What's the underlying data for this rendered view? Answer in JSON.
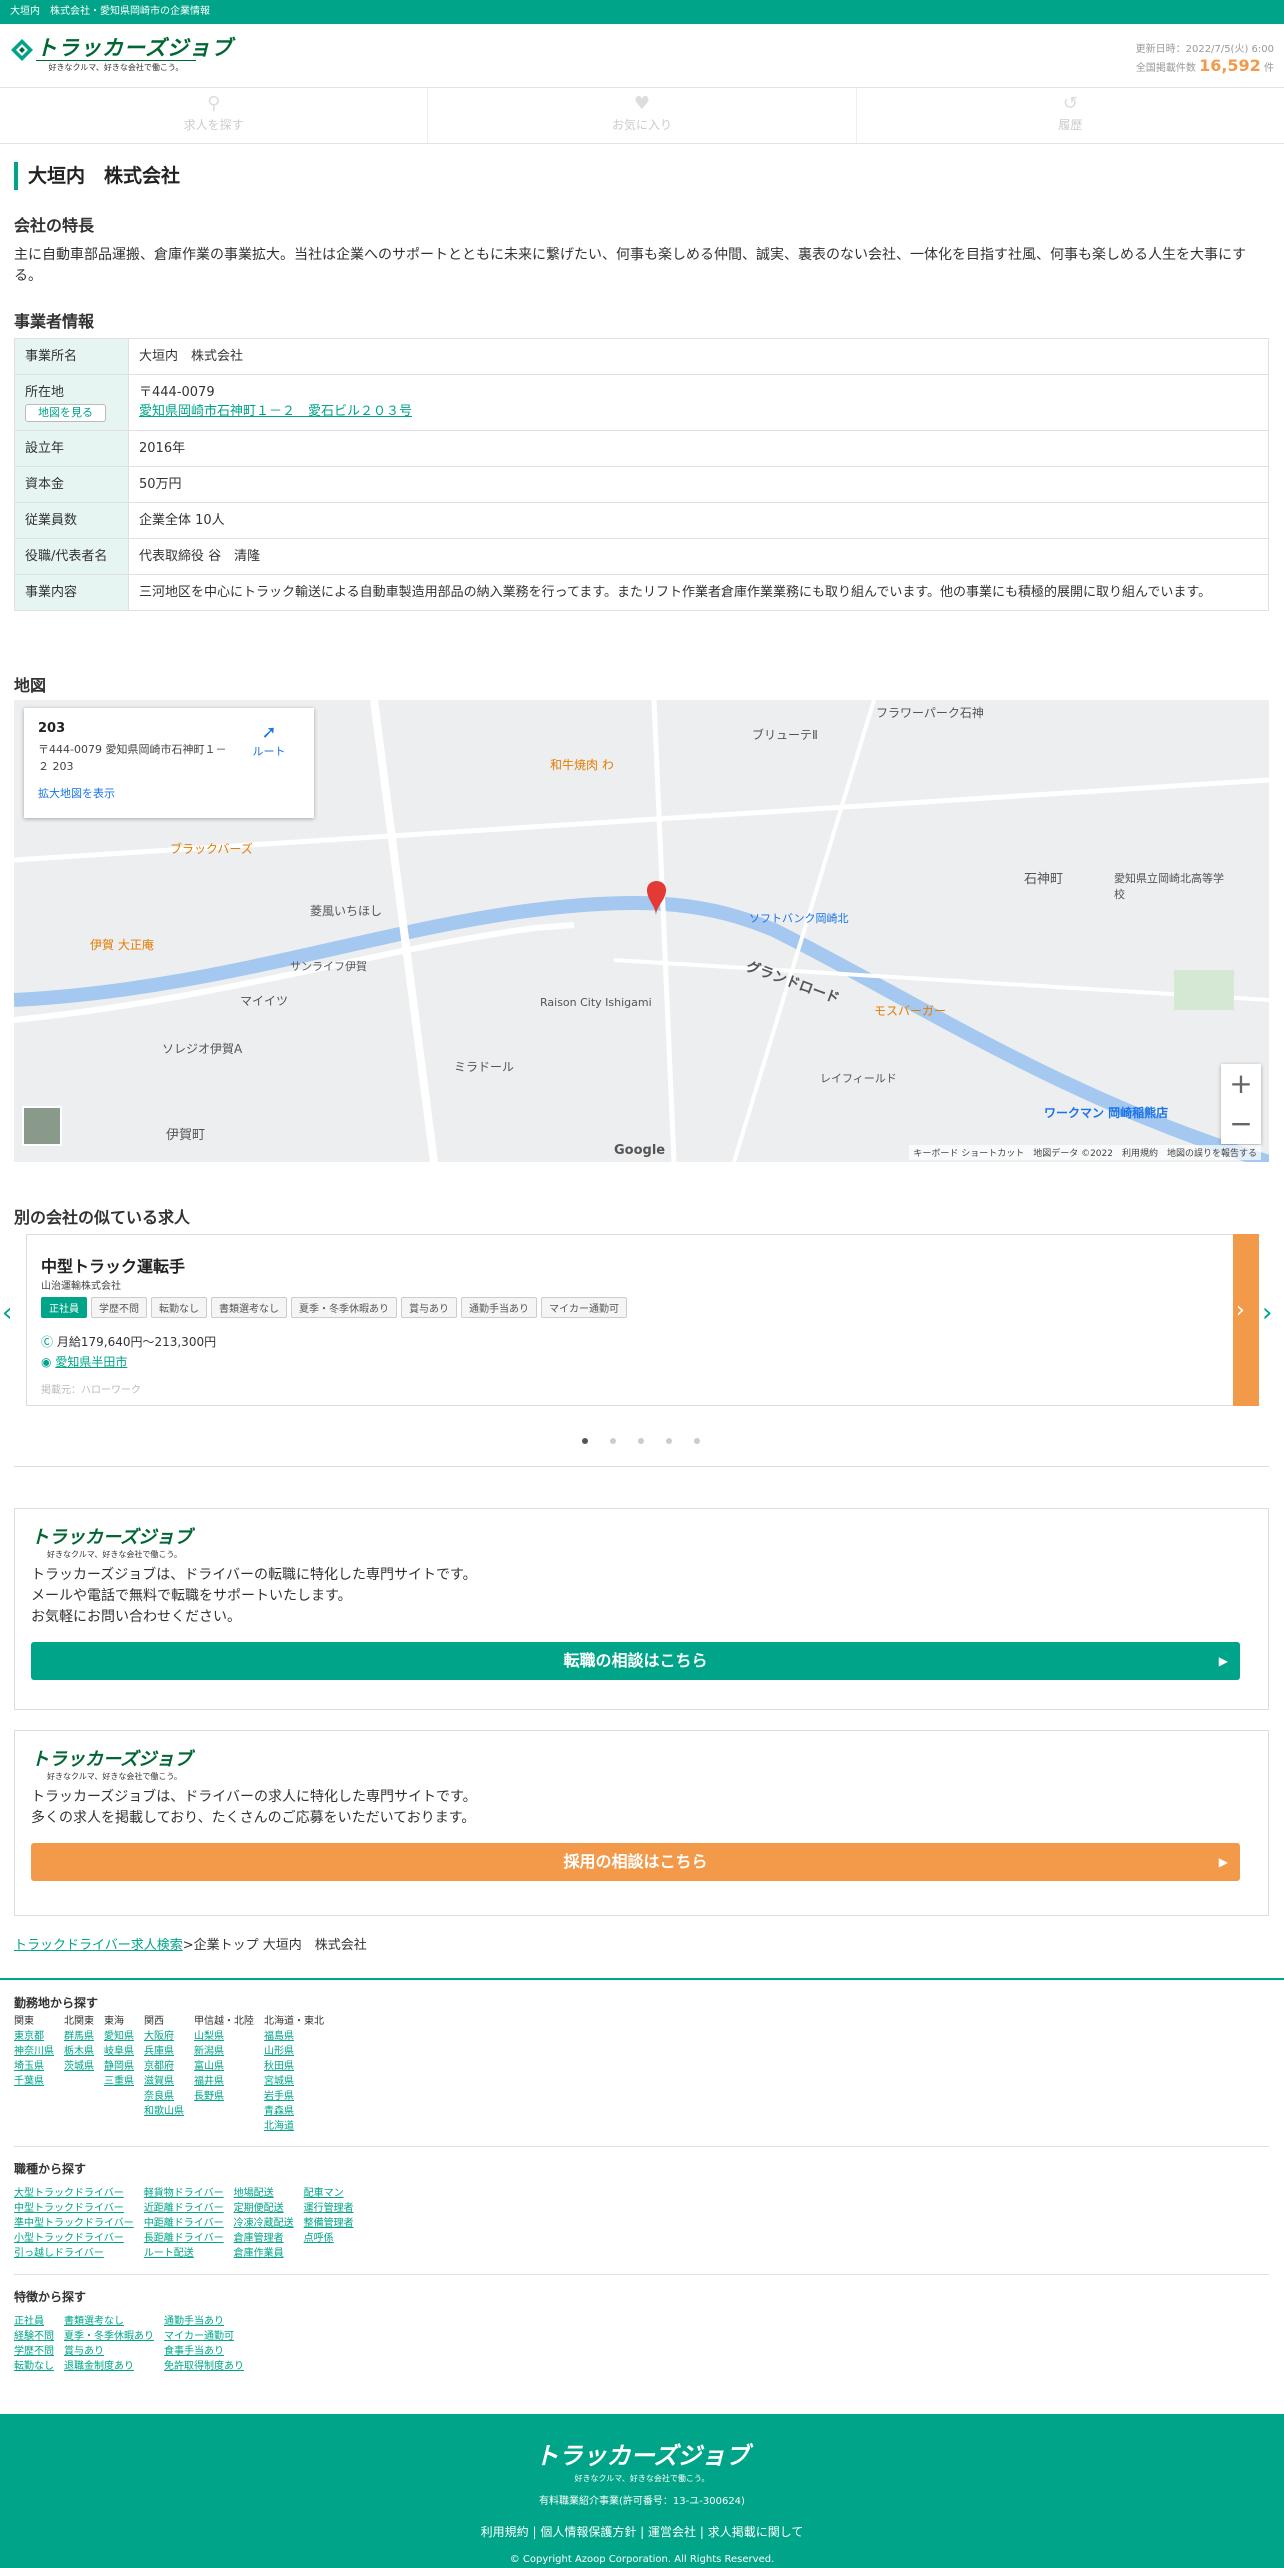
{
  "topbar": {
    "text": "大垣内　株式会社・愛知県岡崎市の企業情報"
  },
  "header": {
    "logo": "トラッカーズジョブ",
    "tagline": "好きなクルマ、好きな会社で働こう。",
    "updated": "更新日時：2022/7/5(火) 6:00",
    "count_label": "全国掲載件数",
    "count_value": "16,592",
    "count_unit": "件"
  },
  "nav": [
    {
      "label": "求人を探す",
      "icon": "search-icon"
    },
    {
      "label": "お気に入り",
      "icon": "heart-icon"
    },
    {
      "label": "履歴",
      "icon": "history-icon"
    }
  ],
  "page_title": "大垣内　株式会社",
  "features": {
    "heading": "会社の特長",
    "text": "主に自動車部品運搬、倉庫作業の事業拡大。当社は企業へのサポートとともに未来に繋げたい、何事も楽しめる仲間、誠実、裏表のない会社、一体化を目指す社風、何事も楽しめる人生を大事にする。"
  },
  "info": {
    "heading": "事業者情報",
    "rows": [
      {
        "k": "事業所名",
        "v": "大垣内　株式会社"
      },
      {
        "k": "所在地",
        "v": "〒444-0079",
        "link": "愛知県岡崎市石神町１－２　愛石ビル２０３号",
        "btn": "地図を見る"
      },
      {
        "k": "設立年",
        "v": "2016年"
      },
      {
        "k": "資本金",
        "v": "50万円"
      },
      {
        "k": "従業員数",
        "v": "企業全体 10人"
      },
      {
        "k": "役職/代表者名",
        "v": "代表取締役 谷　清隆"
      },
      {
        "k": "事業内容",
        "v": "三河地区を中心にトラック輸送による自動車製造用部品の納入業務を行ってます。またリフト作業者倉庫作業業務にも取り組んでいます。他の事業にも積極的展開に取り組んでいます。"
      }
    ]
  },
  "map": {
    "heading": "地図",
    "card_name": "203",
    "card_addr": "〒444-0079 愛知県岡崎市石神町１－２ 203",
    "card_link": "拡大地図を表示",
    "route": "ルート",
    "footer": "キーボード ショートカット　地図データ ©2022　利用規約　地図の誤りを報告する",
    "labels": [
      "グランドロード",
      "石神町",
      "伊賀町",
      "マイイツ",
      "ソレジオ伊賀A",
      "モスバーガー",
      "ワークマン 岡崎稲熊店",
      "Raison City Ishigami",
      "愛知県立岡崎北高等学校",
      "ソフトバンク岡崎北",
      "和牛焼肉 わ",
      "ブラックバーズ",
      "伊賀 大正庵",
      "フラワーパーク石神",
      "ブリューテⅡ",
      "ミラドール",
      "レイフィールド",
      "菱風いちほし",
      "サンライフ伊賀"
    ]
  },
  "similar": {
    "heading": "別の会社の似ている求人",
    "job": {
      "title": "中型トラック運転手",
      "company": "山治運輸株式会社",
      "tags": [
        "正社員",
        "学歴不問",
        "転勤なし",
        "書類選考なし",
        "夏季・冬季休暇あり",
        "賞与あり",
        "通勤手当あり",
        "マイカー通勤可"
      ],
      "salary": "月給179,640円〜213,300円",
      "location": "愛知県半田市",
      "source": "掲載元：ハローワーク"
    }
  },
  "promo1": {
    "lines": [
      "トラッカーズジョブは、ドライバーの転職に特化した専門サイトです。",
      "メールや電話で無料で転職をサポートいたします。",
      "お気軽にお問い合わせください。"
    ],
    "button": "転職の相談はこちら",
    "color": "#00a488"
  },
  "promo2": {
    "lines": [
      "トラッカーズジョブは、ドライバーの求人に特化した専門サイトです。",
      "多くの求人を掲載しており、たくさんのご応募をいただいております。"
    ],
    "button": "採用の相談はこちら",
    "color": "#f29a4a"
  },
  "breadcrumb": {
    "link": "トラックドライバー求人検索",
    "rest": ">企業トップ 大垣内　株式会社"
  },
  "footer_nav": {
    "area_heading": "勤務地から探す",
    "area_cols": [
      {
        "h": "関東",
        "items": [
          "東京都",
          "神奈川県",
          "埼玉県",
          "千葉県"
        ]
      },
      {
        "h": "北関東",
        "items": [
          "群馬県",
          "栃木県",
          "茨城県"
        ]
      },
      {
        "h": "東海",
        "items": [
          "愛知県",
          "岐阜県",
          "静岡県",
          "三重県"
        ]
      },
      {
        "h": "関西",
        "items": [
          "大阪府",
          "兵庫県",
          "京都府",
          "滋賀県",
          "奈良県",
          "和歌山県"
        ]
      },
      {
        "h": "甲信越・北陸",
        "items": [
          "山梨県",
          "新潟県",
          "富山県",
          "福井県",
          "長野県"
        ]
      },
      {
        "h": "北海道・東北",
        "items": [
          "福島県",
          "山形県",
          "秋田県",
          "宮城県",
          "岩手県",
          "青森県",
          "北海道"
        ]
      }
    ],
    "job_heading": "職種から探す",
    "job_cols": [
      {
        "items": [
          "大型トラックドライバー",
          "中型トラックドライバー",
          "準中型トラックドライバー",
          "小型トラックドライバー",
          "引っ越しドライバー"
        ]
      },
      {
        "items": [
          "軽貨物ドライバー",
          "近距離ドライバー",
          "中距離ドライバー",
          "長距離ドライバー",
          "ルート配送"
        ]
      },
      {
        "items": [
          "地場配送",
          "定期便配送",
          "冷凍冷蔵配送",
          "倉庫管理者",
          "倉庫作業員"
        ]
      },
      {
        "items": [
          "配車マン",
          "運行管理者",
          "整備管理者",
          "点呼係"
        ]
      }
    ],
    "feat_heading": "特徴から探す",
    "feat_cols": [
      {
        "items": [
          "正社員",
          "経験不問",
          "学歴不問",
          "転勤なし"
        ]
      },
      {
        "items": [
          "書類選考なし",
          "夏季・冬季休暇あり",
          "賞与あり",
          "退職金制度あり"
        ]
      },
      {
        "items": [
          "通勤手当あり",
          "マイカー通勤可",
          "食事手当あり",
          "免許取得制度あり"
        ]
      }
    ]
  },
  "footer": {
    "logo": "トラッカーズジョブ",
    "tagline": "好きなクルマ、好きな会社で働こう。",
    "license": "有料職業紹介事業(許可番号：13-ユ-300624)",
    "links": [
      "利用規約",
      "個人情報保護方針",
      "運営会社",
      "求人掲載に関して"
    ],
    "copyright": "© Copyright Azoop Corporation. All Rights Reserved."
  }
}
